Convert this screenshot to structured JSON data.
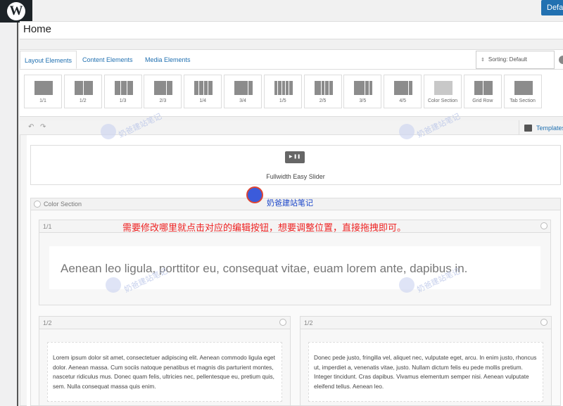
{
  "admin": {
    "default_button": "Default"
  },
  "page": {
    "title": "Home"
  },
  "builder": {
    "tabs": [
      {
        "label": "Layout Elements",
        "active": true
      },
      {
        "label": "Content Elements",
        "active": false
      },
      {
        "label": "Media Elements",
        "active": false
      }
    ],
    "sorting": "Sorting: Default",
    "elements": [
      "1/1",
      "1/2",
      "1/3",
      "2/3",
      "1/4",
      "3/4",
      "1/5",
      "2/5",
      "3/5",
      "4/5",
      "Color Section",
      "Grid Row",
      "Tab Section"
    ]
  },
  "canvas": {
    "templates_label": "Templates",
    "slider_label": "Fullwidth Easy Slider",
    "slider_icon": "▶ ❚❚",
    "color_section_label": "Color Section",
    "row_full_label": "1/1",
    "big_text": "Aenean leo ligula, porttitor eu, consequat vitae, euam lorem ante, dapibus in.",
    "half_left_label": "1/2",
    "half_right_label": "1/2",
    "left_text": "Lorem ipsum dolor sit amet, consectetuer adipiscing elit. Aenean commodo ligula eget dolor. Aenean massa. Cum sociis natoque penatibus et magnis dis parturient montes, nascetur ridiculus mus. Donec quam felis, ultricies nec, pellentesque eu, pretium quis, sem. Nulla consequat massa quis enim.",
    "right_text": "Donec pede justo, fringilla vel, aliquet nec, vulputate eget, arcu. In enim justo, rhoncus ut, imperdiet a, venenatis vitae, justo. Nullam dictum felis eu pede mollis pretium. Integer tincidunt. Cras dapibus. Vivamus elementum semper nisi. Aenean vulputate eleifend tellus. Aenean leo."
  },
  "annotation": {
    "instruction": "需要修改哪里就点击对应的编辑按钮，想要调整位置，直接拖拽即可。",
    "logo": "奶爸建站笔记",
    "watermark": "奶爸建站笔记"
  }
}
